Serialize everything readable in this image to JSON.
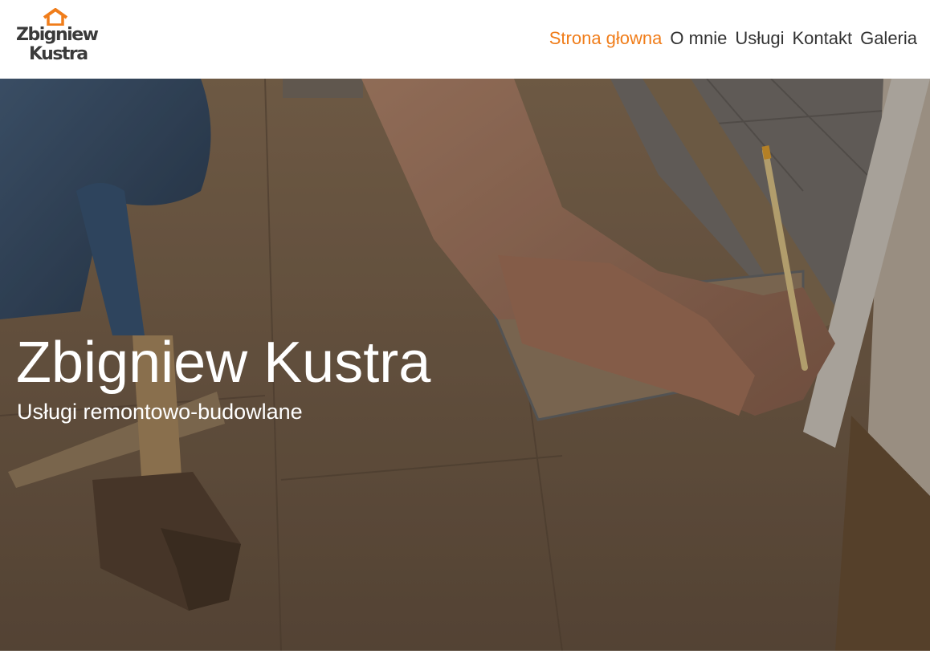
{
  "logo": {
    "line1": "Zbigniew",
    "line2": "Kustra",
    "accent_color": "#f07d1a"
  },
  "nav": {
    "items": [
      {
        "label": "Strona głowna",
        "active": true
      },
      {
        "label": "O mnie",
        "active": false
      },
      {
        "label": "Usługi",
        "active": false
      },
      {
        "label": "Kontakt",
        "active": false
      },
      {
        "label": "Galeria",
        "active": false
      }
    ],
    "active_color": "#f07d1a",
    "text_color": "#333333"
  },
  "hero": {
    "title": "Zbigniew Kustra",
    "subtitle": "Usługi remontowo-budowlane",
    "image_subject": "hands measuring laminate floor panel with pencil, hammer in foreground"
  }
}
